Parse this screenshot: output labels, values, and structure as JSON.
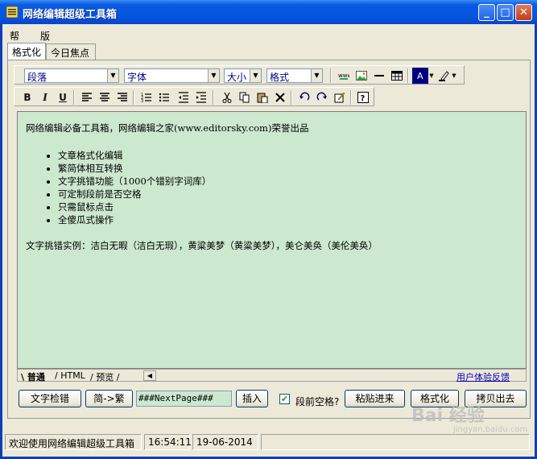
{
  "window": {
    "title": "网络编辑超级工具箱"
  },
  "menu": {
    "help": "帮助",
    "copyright": "版权"
  },
  "top_tabs": [
    {
      "label": "格式化"
    },
    {
      "label": "今日焦点"
    }
  ],
  "toolbar1": {
    "paragraph_select": "段落",
    "font_select": "字体",
    "size_select": "大小",
    "format_select": "格式",
    "font_color": "#000080"
  },
  "toolbar2": {
    "bold": "B",
    "italic": "I",
    "underline": "U"
  },
  "editor": {
    "line1": "网络编辑必备工具箱，网络编辑之家(www.editorsky.com)荣誉出品",
    "items": [
      "文章格式化编辑",
      "繁简体相互转换",
      "文字挑错功能（1000个错别字词库）",
      "可定制段前是否空格",
      "只需鼠标点击",
      "全傻瓜式操作"
    ],
    "line2": "文字挑错实例：洁白无暇（洁白无瑕），黄粱美梦（黄粱美梦），美仑美奂（美伦美奂）",
    "background": "#cce8cf"
  },
  "bottom_tabs": {
    "normal": "普通",
    "html": "HTML",
    "preview": "预览",
    "feedback": "用户体验反馈"
  },
  "actions": {
    "spellcheck": "文字检错",
    "convert": "简->繁",
    "nextpage_value": "###NextPage###",
    "insert": "插入",
    "indent_checked": "✔",
    "indent_label": "段前空格?",
    "paste_in": "粘贴进来",
    "format": "格式化",
    "copy_out": "拷贝出去"
  },
  "status": {
    "message": "欢迎使用网络编辑超级工具箱",
    "time": "16:54:11",
    "date": "19-06-2014"
  },
  "watermark": {
    "text": "Bai 经验",
    "sub": "jingyan.baidu.com"
  }
}
